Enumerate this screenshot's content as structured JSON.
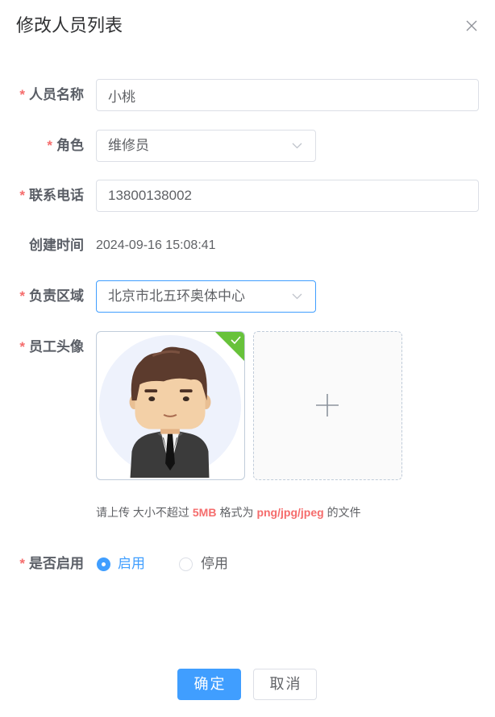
{
  "dialog": {
    "title": "修改人员列表"
  },
  "form": {
    "required_mark": "*",
    "name": {
      "label": "人员名称",
      "required": true,
      "value": "小桃"
    },
    "role": {
      "label": "角色",
      "required": true,
      "value": "维修员"
    },
    "phone": {
      "label": "联系电话",
      "required": true,
      "value": "13800138002"
    },
    "created_at": {
      "label": "创建时间",
      "required": false,
      "value": "2024-09-16 15:08:41"
    },
    "area": {
      "label": "负责区域",
      "required": true,
      "value": "北京市北五环奥体中心",
      "focused": true
    },
    "avatar": {
      "label": "员工头像",
      "required": true,
      "upload_success": true,
      "hint": {
        "prefix": "请上传 大小不超过",
        "size_limit": "5MB",
        "middle": "格式为",
        "formats": "png/jpg/jpeg",
        "suffix": "的文件"
      }
    },
    "enabled": {
      "label": "是否启用",
      "required": true,
      "options": [
        {
          "label": "启用",
          "checked": true
        },
        {
          "label": "停用",
          "checked": false
        }
      ]
    }
  },
  "footer": {
    "confirm_label": "确定",
    "cancel_label": "取消"
  },
  "icons": {
    "close": "close-icon",
    "select_arrow": "chevron-down-icon",
    "upload_add": "plus-icon",
    "upload_status": "check-icon",
    "avatar": "avatar-image"
  },
  "colors": {
    "primary": "#409eff",
    "required": "#f56c6c",
    "success": "#67c23a",
    "highlight": "#f56c6c"
  }
}
